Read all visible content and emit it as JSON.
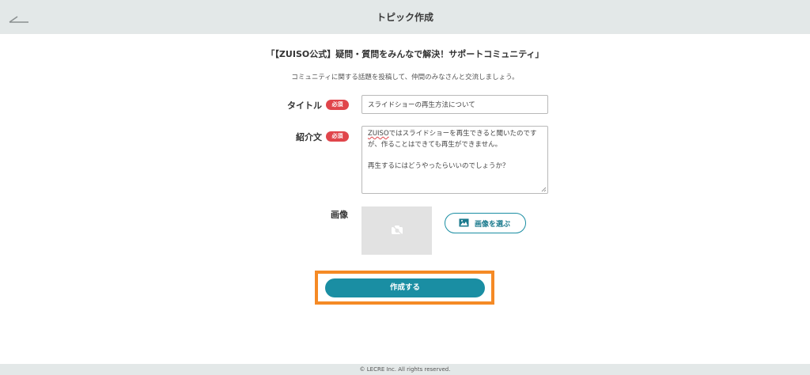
{
  "header": {
    "title": "トピック作成",
    "back_icon": "back-arrow-icon"
  },
  "community": {
    "title": "「【ZUISO公式】疑問・質問をみんなで解決！サポートコミュニティ」",
    "description": "コミュニティに関する話題を投稿して、仲間のみなさんと交流しましょう。"
  },
  "form": {
    "title_label": "タイトル",
    "required_badge": "必須",
    "title_value": "スライドショーの再生方法について",
    "intro_label": "紹介文",
    "intro_line1_underlined": "ZUISO",
    "intro_line1_rest": "ではスライドショーを再生できると聞いたのです",
    "intro_line2": "が、作ることはできても再生ができません。",
    "intro_line3": "再生するにはどうやったらいいのでしょうか？",
    "image_label": "画像",
    "choose_image_label": "画像を選ぶ",
    "submit_label": "作成する"
  },
  "colors": {
    "accent": "#1a8ea3",
    "required": "#e0454b",
    "highlight": "#f58a25",
    "header_bg": "#e3e8e8"
  },
  "footer": {
    "copyright": "© LECRE Inc. All rights reserved."
  }
}
